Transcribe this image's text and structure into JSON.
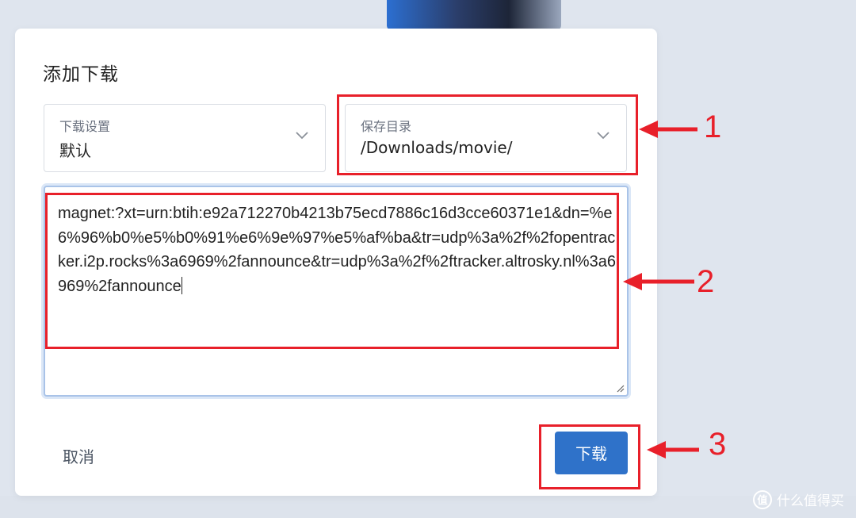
{
  "dialog": {
    "title": "添加下载",
    "download_setting": {
      "label": "下载设置",
      "value": "默认"
    },
    "save_dir": {
      "label": "保存目录",
      "value": "/Downloads/movie/"
    },
    "magnet_text": "magnet:?xt=urn:btih:e92a712270b4213b75ecd7886c16d3cce60371e1&dn=%e6%96%b0%e5%b0%91%e6%9e%97%e5%af%ba&tr=udp%3a%2f%2fopentracker.i2p.rocks%3a6969%2fannounce&tr=udp%3a%2f%2ftracker.altrosky.nl%3a6969%2fannounce",
    "cancel_label": "取消",
    "download_label": "下载"
  },
  "annotations": {
    "labels": [
      "1",
      "2",
      "3"
    ],
    "color": "#e8202a"
  },
  "watermark": {
    "icon_text": "值",
    "text": "什么值得买"
  },
  "colors": {
    "primary": "#2f72c9",
    "background": "#dfe5ee"
  }
}
